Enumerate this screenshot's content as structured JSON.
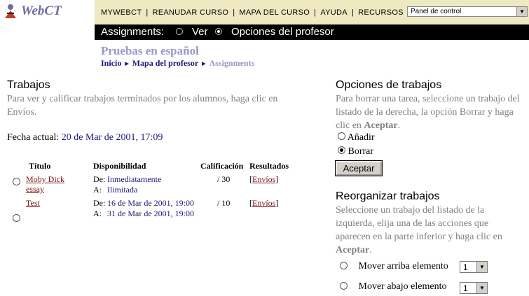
{
  "logo": {
    "text": "WebCT",
    "icon": "webct-logo-icon"
  },
  "topnav": {
    "links": [
      "MYWEBCT",
      "REANUDAR CURSO",
      "MAPA DEL CURSO",
      "AYUDA",
      "RECURSOS"
    ],
    "separator": "|",
    "panel_select": "Panel de control"
  },
  "assignments_bar": {
    "label": "Assignments:",
    "options": [
      {
        "label": "Ver",
        "selected": false
      },
      {
        "label": "Opciones del profesor",
        "selected": true
      }
    ]
  },
  "course": {
    "title": "Pruebas en español",
    "breadcrumb": [
      "Inicio",
      "Mapa del profesor",
      "Assignments"
    ]
  },
  "trabajos": {
    "title": "Trabajos",
    "description": "Para ver y calificar trabajos terminados por los alumnos, haga clic en Envíos.",
    "fecha_label": "Fecha actual:",
    "fecha_value": "20 de Mar de 2001, 17:09",
    "headers": [
      "Título",
      "Disponibilidad",
      "Calificación",
      "Resultados"
    ],
    "rows": [
      {
        "title_line1": "Moby Dick",
        "title_line2": "essay",
        "de_label": "De:",
        "de": "Inmediatamente",
        "a_label": "A:",
        "a": "Ilimitada",
        "grade": "/ 30",
        "results": "Envíos"
      },
      {
        "title_line1": "Test",
        "title_line2": "",
        "de_label": "De:",
        "de": "16 de Mar de 2001, 19:00",
        "a_label": "A:",
        "a": "31 de Mar de 2001, 19:00",
        "grade": "/ 10",
        "results": "Envíos"
      }
    ]
  },
  "opciones": {
    "title": "Opciones de trabajos",
    "desc_part1": "Para borrar una tarea, seleccione un trabajo del listado de la derecha, la opción Borrar y haga clic en ",
    "desc_bold": "Aceptar",
    "desc_end": ".",
    "options": [
      {
        "label": "Añadir",
        "selected": false
      },
      {
        "label": "Borrar",
        "selected": true
      }
    ],
    "button": "Aceptar"
  },
  "reorganizar": {
    "title": "Reorganizar trabajos",
    "desc_part1": "Seleccione un trabajo del listado de la izquierda, elija una de las acciones que aparecen en la parte inferior y haga clic en ",
    "desc_bold": "Aceptar",
    "desc_end": ".",
    "move_up": "Mover arriba elemento",
    "move_up_value": "1",
    "move_down": "Mover abajo elemento",
    "move_down_value": "1"
  }
}
